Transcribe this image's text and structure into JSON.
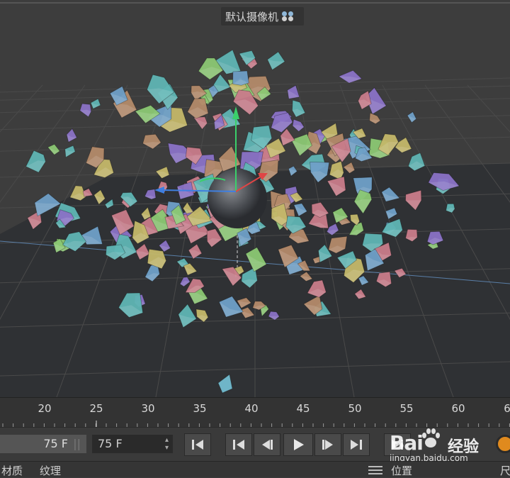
{
  "viewport": {
    "camera_label": "默认摄像机",
    "camera_icon": "camera-icon"
  },
  "timeline": {
    "tick_labels": [
      "20",
      "25",
      "30",
      "35",
      "40",
      "45",
      "50",
      "55",
      "60",
      "6"
    ]
  },
  "controls": {
    "frame_current": "75 F",
    "frame_end": "75 F",
    "buttons": [
      "go-to-start-icon",
      "previous-key-icon",
      "step-back-icon",
      "play-icon",
      "step-forward-icon",
      "next-key-icon",
      "go-to-end-icon"
    ]
  },
  "panels": {
    "tab_material": "材质",
    "tab_texture": "纹理",
    "tab_position": "位置",
    "tab_cut": "尺"
  },
  "watermark": {
    "logo": "Bai",
    "brand": "经验",
    "site": "jingyan.baidu.com"
  },
  "colors": {
    "shard_palette": [
      "#c97c8a",
      "#8bc873",
      "#8a72c6",
      "#5fb5b4",
      "#c4b86a",
      "#b48a6a",
      "#6fa0c8"
    ]
  }
}
